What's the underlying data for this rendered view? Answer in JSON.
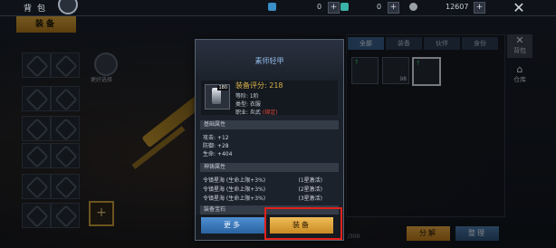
{
  "topbar": {
    "back_label": "背包",
    "resources": [
      {
        "icon": "diamond-icon",
        "value": "0",
        "color": "#3a8fc9"
      },
      {
        "icon": "gem-icon",
        "value": "0",
        "color": "#3bb3a8"
      },
      {
        "icon": "coin-icon",
        "value": "12607",
        "color": "#9aa0a8"
      }
    ],
    "plus": "+",
    "close_glyph": "✕"
  },
  "left": {
    "tab_label": "装备",
    "skill_label": "更好选择",
    "add_glyph": "+"
  },
  "right_panel": {
    "tabs": [
      "全部",
      "装备",
      "伙伴",
      "身份"
    ],
    "active_tab": 0,
    "items": [
      {
        "count": "",
        "upgrade": "↑",
        "selected": false
      },
      {
        "count": "98",
        "upgrade": "",
        "selected": false
      },
      {
        "count": "",
        "upgrade": "↑",
        "selected": true
      }
    ],
    "count_text": "/300",
    "btn_decompose": "分解",
    "btn_sort": "整理"
  },
  "side_menu": {
    "items": [
      {
        "label": "背包",
        "icon": "bag-icon",
        "glyph": "✕",
        "active": true
      },
      {
        "label": "仓库",
        "icon": "warehouse-icon",
        "glyph": "⌂",
        "active": false
      }
    ]
  },
  "popup": {
    "title": "素师轻甲",
    "item_tier": "180",
    "score_label": "装备评分:",
    "score_value": "218",
    "level": "等阶: 1阶",
    "type": "类型: 衣服",
    "profession_prefix": "职业: 炎武",
    "profession_bound": "(绑定)",
    "section_base": "基础属性",
    "base_attrs": [
      "攻击: +12",
      "防御: +28",
      "生命: +404"
    ],
    "section_spirit": "神铸属性",
    "spirit_attrs": [
      {
        "text": "令镇星海 (生命上限+3%)",
        "state": "(1星激活)"
      },
      {
        "text": "令镇星海 (生命上限+3%)",
        "state": "(2星激活)"
      },
      {
        "text": "令镇星海 (生命上限+3%)",
        "state": "(3星激活)"
      }
    ],
    "section_gem": "装备宝石",
    "btn_more": "更多",
    "btn_equip": "装备"
  }
}
